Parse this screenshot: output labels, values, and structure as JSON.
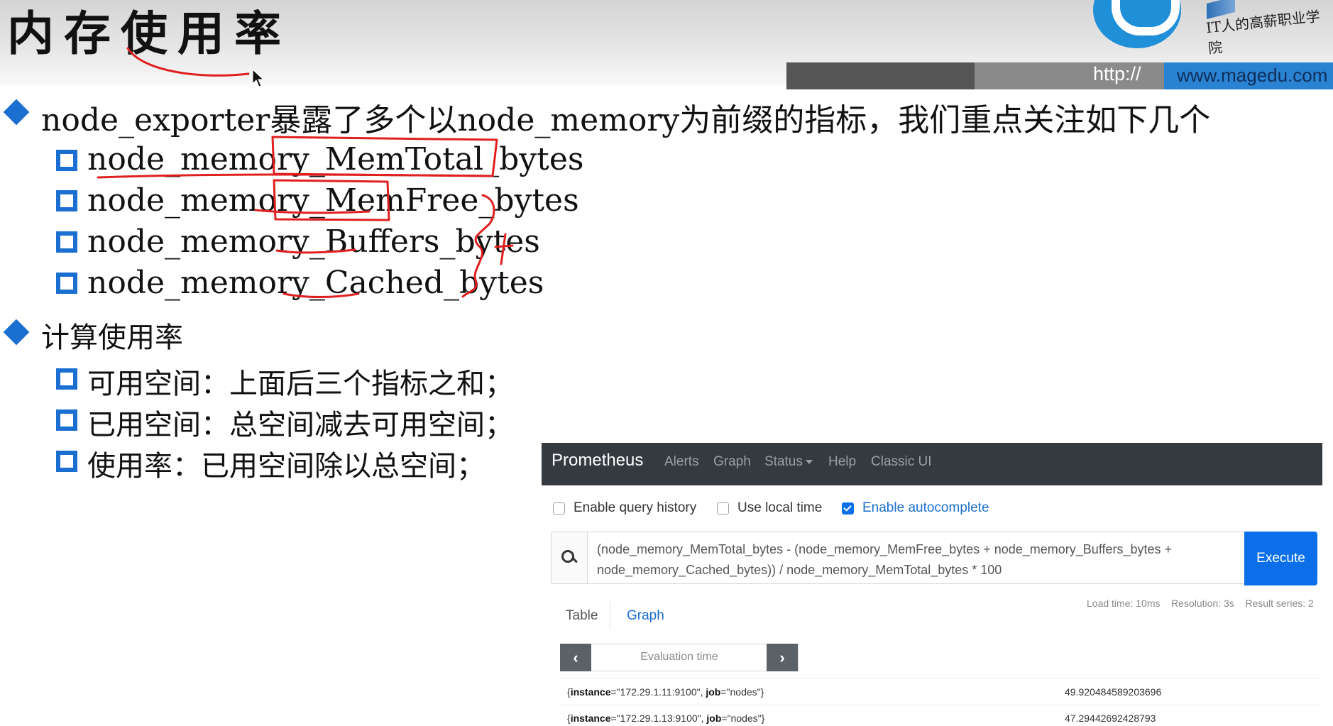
{
  "slide": {
    "title": "内存使用率",
    "url_prefix": "http://",
    "url": "www.magedu.com",
    "logo_text": "IT人的高薪职业学院",
    "bullet1": "node_exporter暴露了多个以node_memory为前缀的指标，我们重点关注如下几个",
    "metrics": [
      "node_memory_MemTotal_bytes",
      "node_memory_MemFree_bytes",
      "node_memory_Buffers_bytes",
      "node_memory_Cached_bytes"
    ],
    "annotation_plus": "+",
    "bullet2": "计算使用率",
    "sub2": [
      "可用空间：上面后三个指标之和；",
      "已用空间：总空间减去可用空间；",
      "使用率：已用空间除以总空间；"
    ]
  },
  "prometheus": {
    "brand": "Prometheus",
    "nav": [
      "Alerts",
      "Graph",
      "Status",
      "Help",
      "Classic UI"
    ],
    "options": [
      {
        "label": "Enable query history",
        "checked": false
      },
      {
        "label": "Use local time",
        "checked": false
      },
      {
        "label": "Enable autocomplete",
        "checked": true
      }
    ],
    "query_line1": "(node_memory_MemTotal_bytes - (node_memory_MemFree_bytes + node_memory_Buffers_bytes +",
    "query_line2": "node_memory_Cached_bytes)) / node_memory_MemTotal_bytes * 100",
    "execute": "Execute",
    "stats": {
      "load_time": "Load time: 10ms",
      "resolution": "Resolution: 3s",
      "result_series": "Result series: 2"
    },
    "tabs": [
      "Table",
      "Graph"
    ],
    "active_tab": "Graph",
    "eval_prev": "‹",
    "eval_next": "›",
    "eval_placeholder": "Evaluation time",
    "results": [
      {
        "open": "{",
        "k1": "instance",
        "v1": "=\"172.29.1.11:9100\", ",
        "k2": "job",
        "v2": "=\"nodes\"}",
        "value": "49.920484589203696"
      },
      {
        "open": "{",
        "k1": "instance",
        "v1": "=\"172.29.1.13:9100\", ",
        "k2": "job",
        "v2": "=\"nodes\"}",
        "value": "47.29442692428793"
      }
    ]
  },
  "colors": {
    "accent_blue": "#1a6fd0",
    "prom_nav": "#343a40",
    "execute_blue": "#0a6fe8",
    "ink_red": "#e02020"
  }
}
